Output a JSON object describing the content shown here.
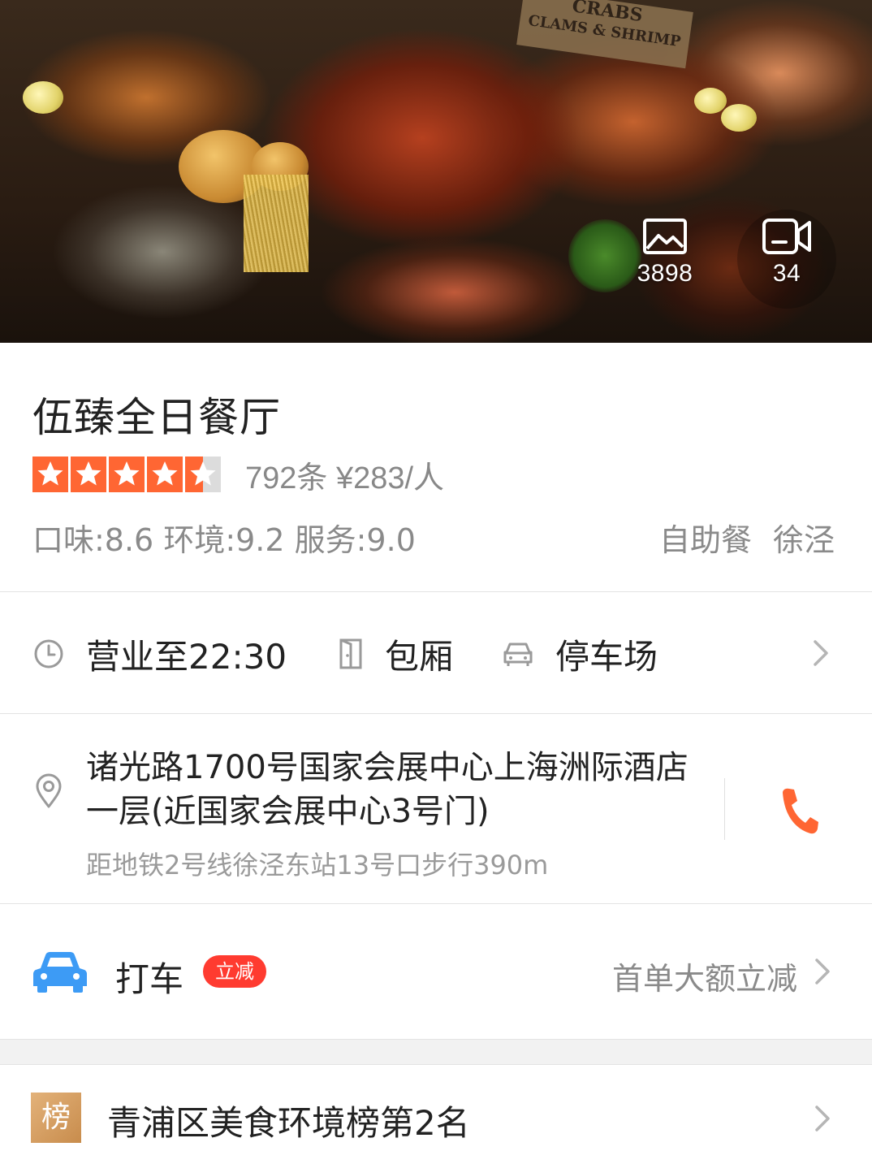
{
  "hero": {
    "sign_text_1": "CRABS",
    "sign_text_2": "CLAMS & SHRIMP",
    "photo_count": "3898",
    "video_count": "34"
  },
  "restaurant": {
    "name": "伍臻全日餐厅",
    "rating_stars": 4.5,
    "rating_text": "792条 ¥283/人",
    "scores": "口味:8.6 环境:9.2 服务:9.0",
    "tags": [
      "自助餐",
      "徐泾"
    ]
  },
  "facilities": {
    "hours": "营业至22:30",
    "private_room": "包厢",
    "parking": "停车场"
  },
  "address": {
    "line": "诸光路1700号国家会展中心上海洲际酒店一层(近国家会展中心3号门)",
    "metro": "距地铁2号线徐泾东站13号口步行390m"
  },
  "taxi": {
    "label": "打车",
    "badge": "立减",
    "promo": "首单大额立减"
  },
  "rank": {
    "badge": "榜",
    "label": "青浦区美食环境榜第2名"
  },
  "colors": {
    "star": "#ff6633",
    "phone": "#ff6633",
    "taxi_car": "#3d9bf5",
    "badge": "#ff3b30",
    "rank_badge": "#d9a062"
  }
}
